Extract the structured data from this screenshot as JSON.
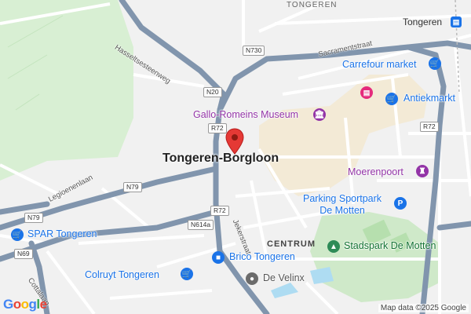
{
  "map": {
    "city_label": "Tongeren-Borgloon",
    "district_label": "CENTRUM",
    "top_label": "TONGEREN",
    "station_label": "Tongeren",
    "attribution": "Map data ©2025 Google",
    "google_logo": "Google",
    "colors": {
      "primary_road": "#7f94ad",
      "secondary_road": "#ffffff",
      "park": "#d4ecd0",
      "green_area": "#b9e0b4",
      "water": "#aedcf2",
      "marker": "#e53935",
      "old_town": "#f4e8cc",
      "poi_blue": "#1a73e8",
      "poi_purple": "#9334a7",
      "poi_pink": "#e52b7c"
    }
  },
  "places": [
    {
      "label": "Carrefour market",
      "icon": "shopping-cart-icon"
    },
    {
      "label": "Antiekmarkt",
      "icon": "shopping-cart-icon"
    },
    {
      "label": "Gallo-Romeins Museum",
      "icon": "museum-icon"
    },
    {
      "label": "Moerenpoort",
      "icon": "castle-icon"
    },
    {
      "label": "Parking Sportpark\nDe Motten",
      "line1": "Parking Sportpark",
      "line2": "De Motten",
      "icon": "parking-icon"
    },
    {
      "label": "Stadspark De Motten",
      "icon": "tree-icon"
    },
    {
      "label": "SPAR Tongeren",
      "icon": "shopping-cart-icon"
    },
    {
      "label": "Brico Tongeren",
      "icon": "shopping-bag-icon"
    },
    {
      "label": "Colruyt Tongeren",
      "icon": "shopping-cart-icon"
    },
    {
      "label": "De Velinx",
      "icon": "theater-icon"
    }
  ],
  "roads": {
    "hasseltsesteenweg": "Hasseltsesteenweg",
    "sacramentstraat": "Sacramentstraat",
    "legioenenlaan": "Legioenenlaan",
    "jekerstraat": "Jekerstraat",
    "cottalaan": "Cottalaan"
  },
  "shields": {
    "n730": "N730",
    "n20": "N20",
    "r72_top": "R72",
    "r72_mid": "R72",
    "r72_right": "R72",
    "n79_mid": "N79",
    "n79_left": "N79",
    "n614a": "N614a",
    "n69": "N69"
  }
}
